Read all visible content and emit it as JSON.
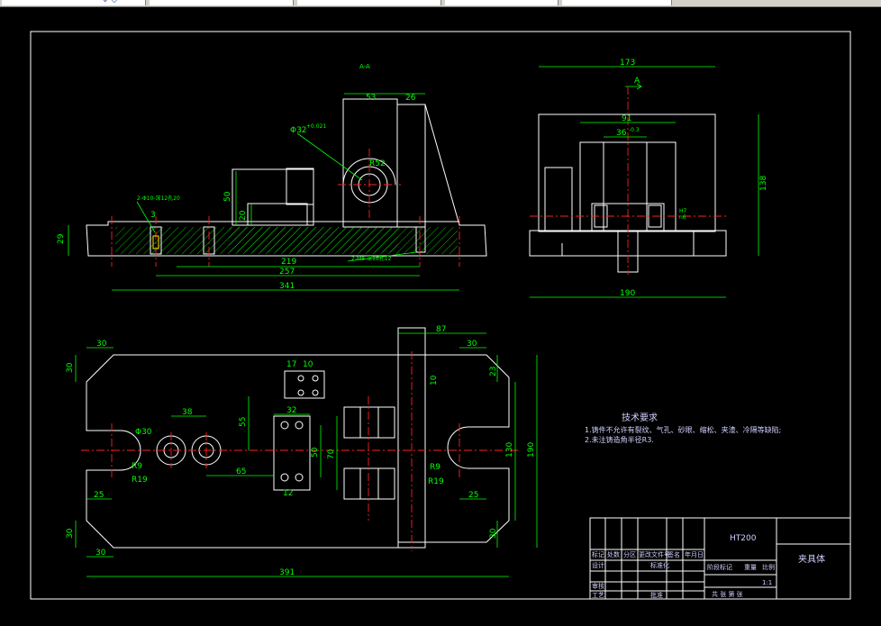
{
  "window": {
    "tabs": [
      "",
      "",
      "",
      "",
      ""
    ]
  },
  "drawing": {
    "section_label": "A-A",
    "view_arrow_label": "A",
    "technical_requirements": {
      "title": "技术要求",
      "items": [
        "1.铸件不允许有裂纹、气孔、砂眼、缩松、夹渣、冷隔等缺陷;",
        "2.未注铸造角半径R3."
      ]
    },
    "title_block": {
      "material": "HT200",
      "part_name": "夹具体",
      "scale": "1:1",
      "row_labels": [
        "标记",
        "处数",
        "分区",
        "更改文件号",
        "签名",
        "年月日"
      ],
      "left_labels": [
        "设计",
        "审核",
        "工艺"
      ],
      "mid_labels": [
        "标准化",
        "批准"
      ],
      "stage_labels": [
        "阶段标记",
        "重量",
        "比例"
      ],
      "bottom": "共 张 第 张"
    },
    "dimensions": {
      "front_view": [
        "53",
        "26",
        "50",
        "20",
        "29",
        "3",
        "219",
        "257",
        "341",
        "R52",
        "Φ32",
        "+0.021",
        "2-Φ10-深12孔20",
        "2-M8-深16孔12"
      ],
      "side_view": [
        "173",
        "138",
        "91",
        "36",
        "-0.3",
        "H7",
        "n6",
        "190"
      ],
      "top_view": [
        "30",
        "30",
        "38",
        "Φ30",
        "R9",
        "R19",
        "25",
        "65",
        "55",
        "32",
        "17",
        "10",
        "50",
        "70",
        "87",
        "30",
        "23",
        "10",
        "130",
        "190",
        "R9",
        "R19",
        "25",
        "30",
        "30",
        "30",
        "391",
        "12"
      ]
    }
  }
}
